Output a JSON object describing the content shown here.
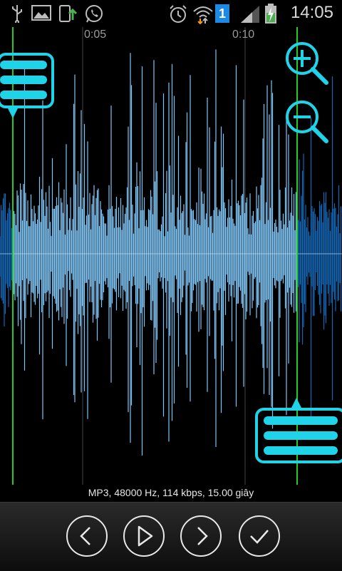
{
  "status_bar": {
    "time": "14:05",
    "notification_badge": "1",
    "icons": [
      "usb-icon",
      "image-icon",
      "upload-icon",
      "whatsapp-icon",
      "alarm-icon",
      "wifi-icon",
      "signal-icon",
      "battery-icon"
    ]
  },
  "timeline": {
    "markers": [
      "0:05",
      "0:10"
    ]
  },
  "audio_info": "MP3, 48000 Hz, 114 kbps, 15.00 giây",
  "toolbar": {
    "buttons": [
      "previous-button",
      "play-button",
      "next-button",
      "confirm-button"
    ]
  },
  "colors": {
    "selection_wave": "#7fc4f4",
    "outside_wave": "#1565b0",
    "marker_line": "#22cc22",
    "handle_cyan": "#1fd3e8"
  }
}
